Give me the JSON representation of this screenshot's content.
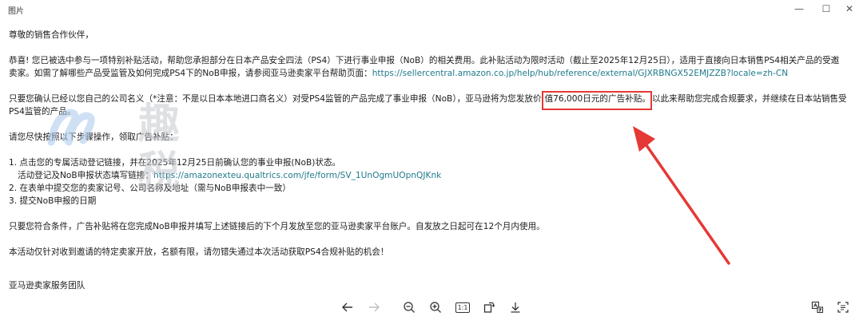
{
  "window": {
    "title": "图片",
    "minimize_glyph": "—",
    "maximize_glyph": "☐",
    "close_glyph": "✕"
  },
  "email": {
    "greeting": "尊敬的销售合作伙伴，",
    "para1_line1": "恭喜! 您已被选中参与一项特别补贴活动，帮助您承担部分在日本产品安全四法（PS4）下进行事业申报（NoB）的相关费用。此补贴活动为限时活动（截止至2025年12月25日），适用于直接向日本销售PS4相关产品的受邀",
    "para1_line2_text": "卖家。如需了解哪些产品受监管及如何完成PS4下的NoB申报，请参阅亚马逊卖家平台帮助页面：",
    "para1_link": "https://sellercentral.amazon.co.jp/help/hub/reference/external/GJXRBNGX52EMJZZB?locale=zh-CN",
    "para2_line1_before": "只要您确认已经以您自己的公司名义（*注意：不是以日本本地进口商名义）对受PS4监管的产品完成了事业申报（NoB），亚马逊将为您发放价",
    "para2_highlight": "值76,000日元的广告补贴。",
    "para2_line1_after": "以此来帮助您完成合规要求，并继续在日本站销售受",
    "para2_line2": "PS4监管的产品。",
    "steps_intro": "请您尽快按照以下步骤操作，领取广告补贴：",
    "step1": "1. 点击您的专属活动登记链接，并在2025年12月25日前确认您的事业申报(NoB)状态。",
    "step1_sub_text": "活动登记及NoB申报状态填写链接：",
    "step1_link": "https://amazonexteu.qualtrics.com/jfe/form/SV_1UnOgmUOpnQJKnk",
    "step2": "2. 在表单中提交您的卖家记号、公司名称及地址（需与NoB申报表中一致）",
    "step3": "3. 提交NoB申报的日期",
    "para3": "只要您符合条件，广告补贴将在您完成NoB申报并填写上述链接后的下个月发放至您的亚马逊卖家平台账户。自发放之日起可在12个月内使用。",
    "para4": "本活动仅针对收到邀请的特定卖家开放，名额有限，请勿错失通过本次活动获取PS4合规补贴的机会！",
    "signature": "亚马逊卖家服务团队"
  },
  "watermark": {
    "text": "趣税"
  },
  "toolbar": {
    "fit_label": "1:1"
  },
  "colors": {
    "highlight": "#e53935",
    "link": "#1f7a8c"
  }
}
